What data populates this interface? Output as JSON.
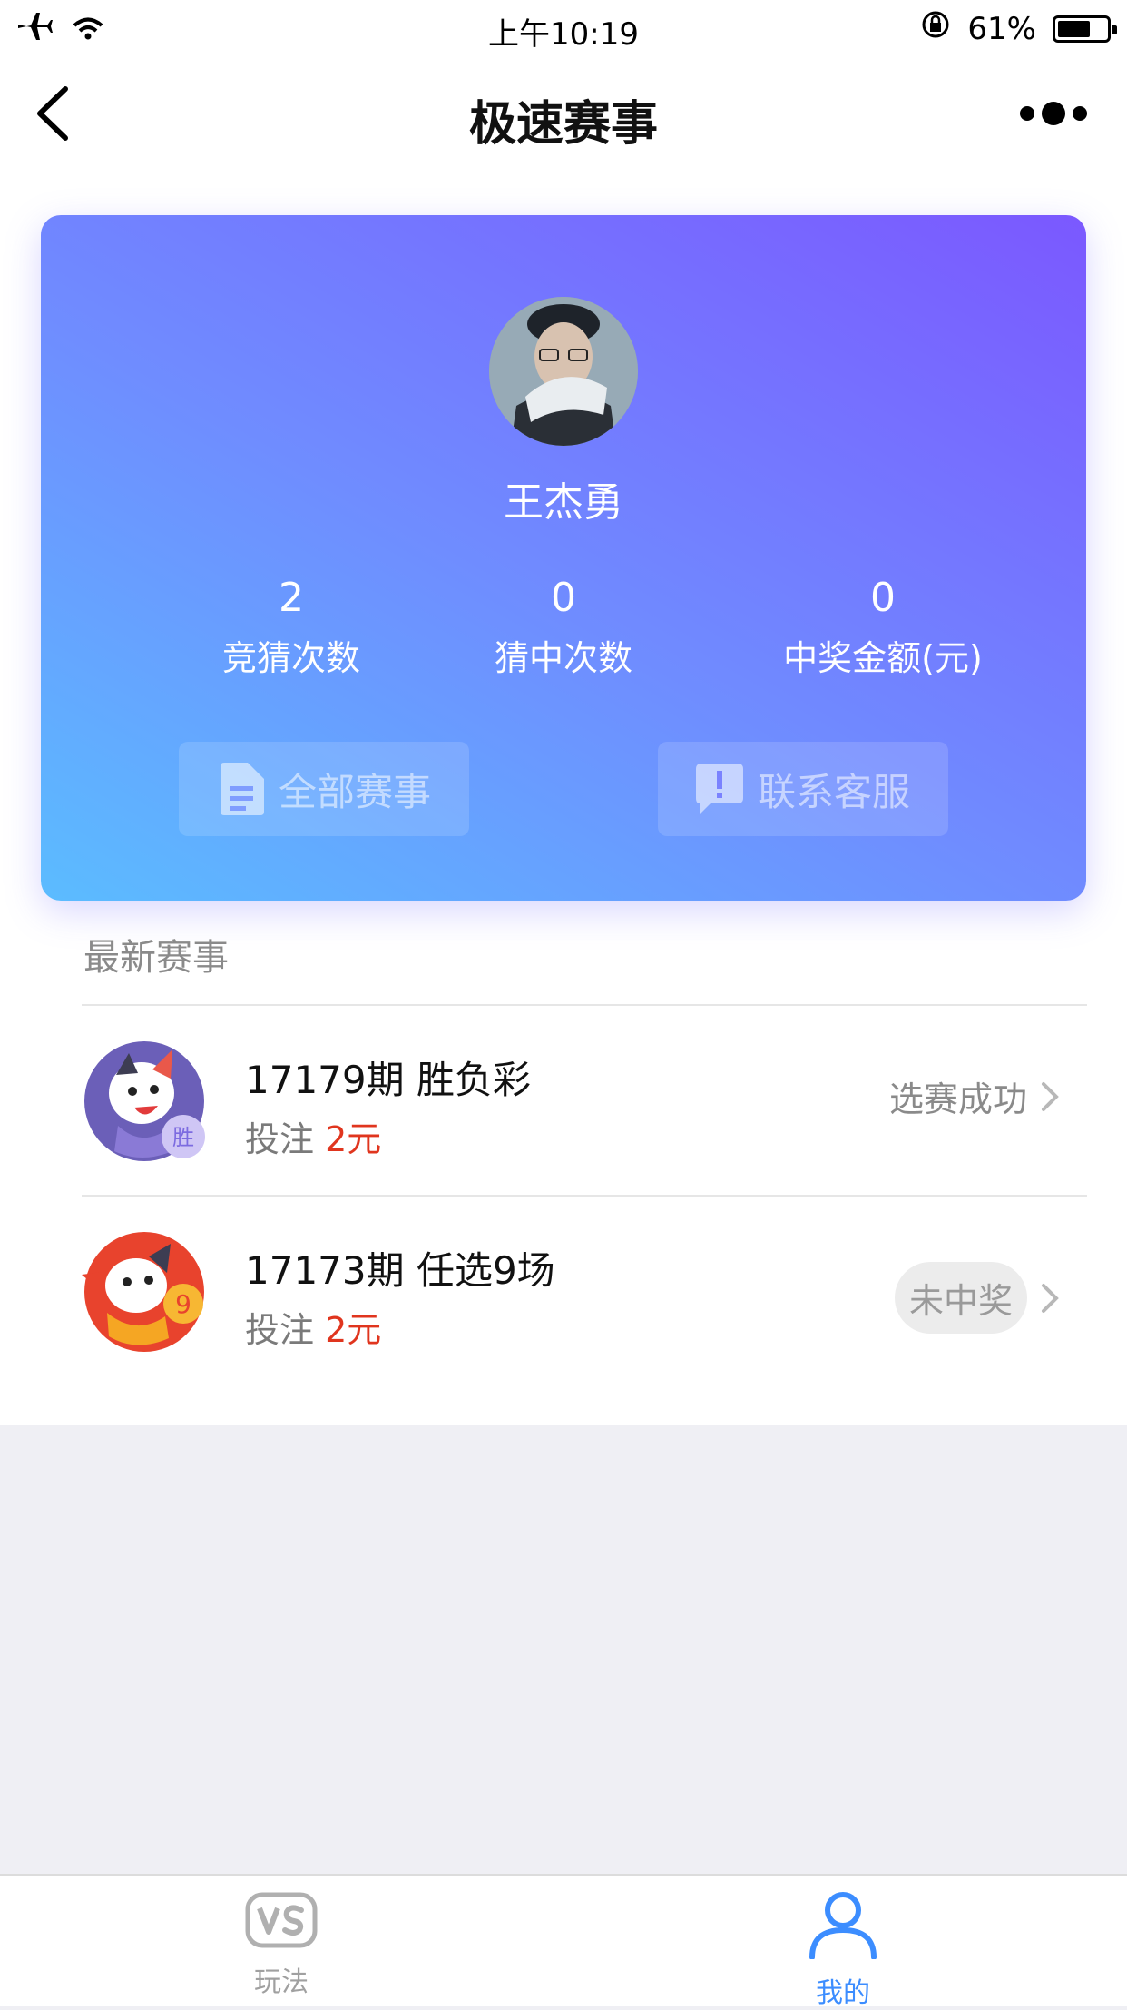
{
  "status_bar": {
    "time": "上午10:19",
    "battery": "61%"
  },
  "nav": {
    "title": "极速赛事"
  },
  "profile": {
    "name": "王杰勇",
    "stats": [
      {
        "value": "2",
        "label": "竞猜次数"
      },
      {
        "value": "0",
        "label": "猜中次数"
      },
      {
        "value": "0",
        "label": "中奖金额(元)"
      }
    ],
    "buttons": {
      "all_matches": "全部赛事",
      "contact": "联系客服"
    }
  },
  "latest": {
    "title": "最新赛事",
    "items": [
      {
        "title": "17179期 胜负彩",
        "bet_prefix": "投注",
        "amount": "2元",
        "status": "选赛成功",
        "badge": "胜"
      },
      {
        "title": "17173期 任选9场",
        "bet_prefix": "投注",
        "amount": "2元",
        "status": "未中奖",
        "badge": "9"
      }
    ]
  },
  "tabbar": {
    "tabs": [
      {
        "label": "玩法",
        "icon": "vs-icon",
        "active": false
      },
      {
        "label": "我的",
        "icon": "user-icon",
        "active": true
      }
    ],
    "active_color": "#3c8dff",
    "inactive_color": "#a0a0a0"
  }
}
